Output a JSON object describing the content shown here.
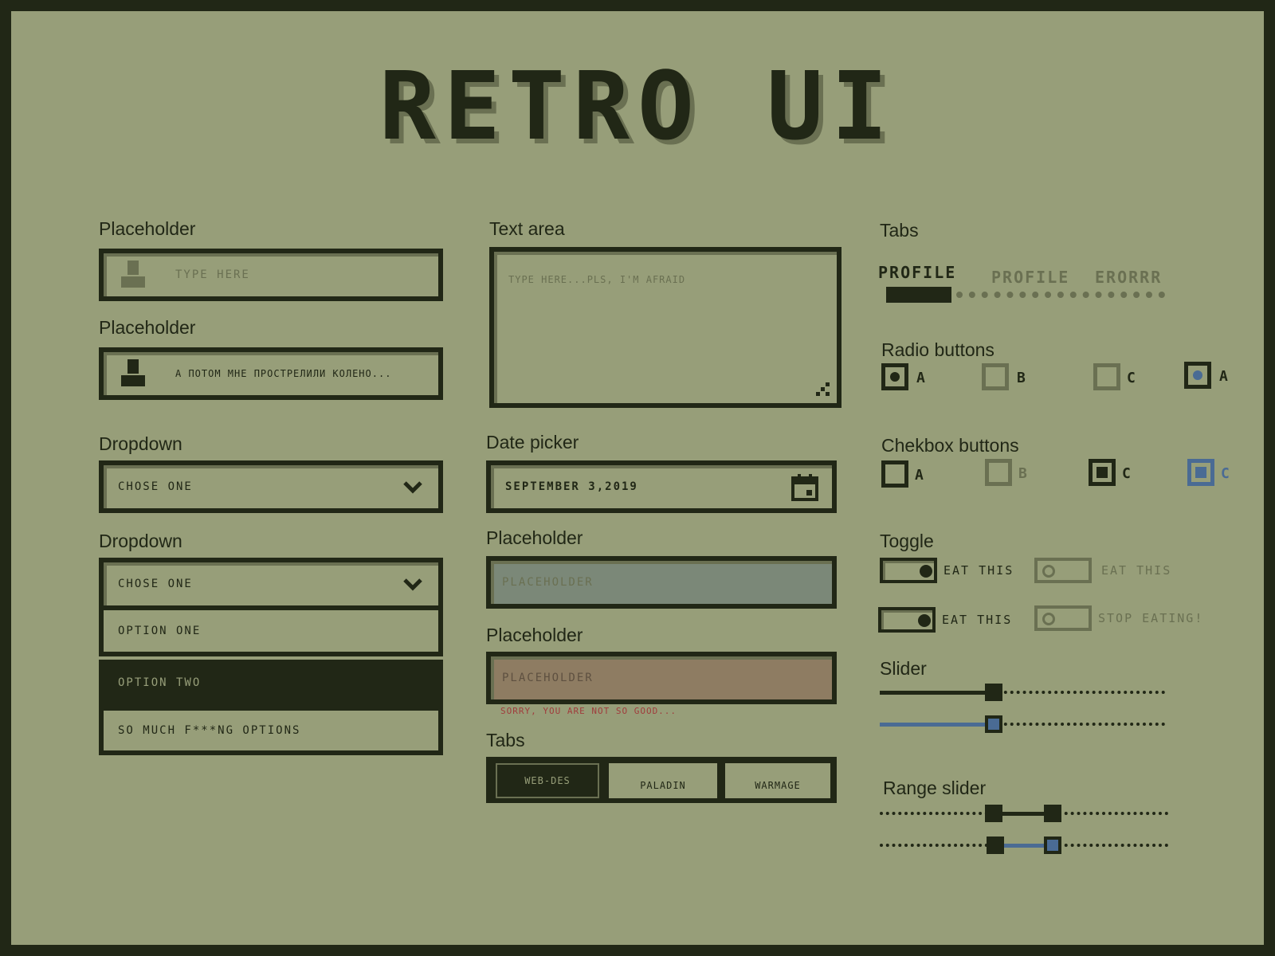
{
  "title": "RETRO UI",
  "colors": {
    "background": "#979e79",
    "dark": "#212716",
    "muted": "#6a7052",
    "accent": "#4a6b94",
    "error": "#a03c3c",
    "field_blue": "#7b8878",
    "field_red": "#8e7c62"
  },
  "left": {
    "input1": {
      "label": "Placeholder",
      "placeholder": "TYPE HERE",
      "icon": "user-icon"
    },
    "input2": {
      "label": "Placeholder",
      "value": "А ПОТОМ МНЕ ПРОСТРЕЛИЛИ КОЛЕНО...",
      "icon": "user-icon"
    },
    "dropdown1": {
      "label": "Dropdown",
      "value": "CHOSE ONE"
    },
    "dropdown2": {
      "label": "Dropdown",
      "value": "CHOSE ONE",
      "options": [
        "OPTION ONE",
        "OPTION TWO",
        "SO MUCH F***NG OPTIONS"
      ],
      "highlighted": "OPTION TWO"
    }
  },
  "middle": {
    "textarea": {
      "label": "Text area",
      "placeholder": "TYPE HERE...PLS, I'M AFRAID"
    },
    "datepicker": {
      "label": "Date picker",
      "value": "SEPTEMBER 3,2019",
      "icon": "calendar-icon"
    },
    "disabled_input": {
      "label": "Placeholder",
      "placeholder": "PLACEHOLDER"
    },
    "error_input": {
      "label": "Placeholder",
      "placeholder": "PLACEHOLDER",
      "error": "SORRY, YOU ARE NOT SO GOOD..."
    },
    "tabs": {
      "label": "Tabs",
      "items": [
        "WEB-DES",
        "PALADIN",
        "WARMAGE"
      ],
      "active": "WEB-DES"
    }
  },
  "right": {
    "tabs": {
      "label": "Tabs",
      "items": [
        "PROFILE",
        "PROFILE",
        "ERORRR"
      ],
      "active": "PROFILE"
    },
    "radio": {
      "label": "Radio buttons",
      "items": [
        {
          "text": "A",
          "state": "checked"
        },
        {
          "text": "B",
          "state": "disabled"
        },
        {
          "text": "C",
          "state": "disabled"
        },
        {
          "text": "A",
          "state": "checked-accent"
        }
      ]
    },
    "checkbox": {
      "label": "Chekbox buttons",
      "items": [
        {
          "text": "A",
          "state": "unchecked"
        },
        {
          "text": "B",
          "state": "disabled"
        },
        {
          "text": "C",
          "state": "checked"
        },
        {
          "text": "C",
          "state": "checked-accent"
        }
      ]
    },
    "toggle": {
      "label": "Toggle",
      "items": [
        {
          "text": "EAT THIS",
          "on": true
        },
        {
          "text": "EAT THIS",
          "on": false
        },
        {
          "text": "EAT THIS",
          "on": true
        },
        {
          "text": "STOP EATING!",
          "on": false
        }
      ]
    },
    "slider": {
      "label": "Slider",
      "value_fraction": 0.4
    },
    "range": {
      "label": "Range slider",
      "low_fraction": 0.4,
      "high_fraction": 0.6
    }
  }
}
